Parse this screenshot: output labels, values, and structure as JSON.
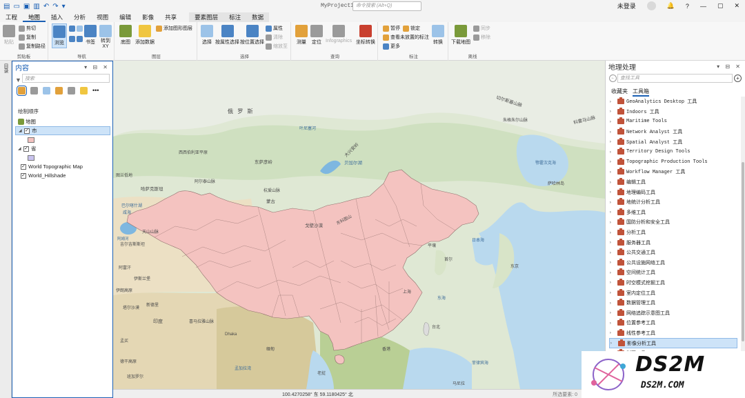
{
  "titlebar": {
    "project": "MyProject10",
    "command_search_placeholder": "命令搜索 (Alt+Q)",
    "signin": "未登录",
    "help": "?",
    "minimize": "—",
    "maximize": "▢",
    "close": "✕",
    "notify": "🔔"
  },
  "tabs": [
    "工程",
    "地图",
    "插入",
    "分析",
    "视图",
    "编辑",
    "影像",
    "共享",
    "要素图层",
    "标注",
    "数据"
  ],
  "ribbon": {
    "clipboard": {
      "label": "剪贴板",
      "paste": "粘贴",
      "cut": "剪切",
      "copy": "复制",
      "copy_path": "复制路径"
    },
    "navigate": {
      "label": "导航",
      "explore": "浏览",
      "bookmarks": "书签",
      "go_to": "转到 XY"
    },
    "layer": {
      "label": "图层",
      "basemap": "底图",
      "add_data": "添加数据",
      "add_graphics": "添加图形图层"
    },
    "selection": {
      "label": "选择",
      "select": "选择",
      "by_attr": "按属性选择",
      "by_loc": "按位置选择",
      "attributes": "属性",
      "clear": "清除",
      "zoom_to": "缩放至"
    },
    "inquiry": {
      "label": "查询",
      "measure": "测量",
      "locate": "定位",
      "infographics": "Infographics",
      "coord": "坐标转换"
    },
    "labeling": {
      "label": "标注",
      "pause": "暂停",
      "lock": "锁定",
      "view_unplaced": "查看未放置的标注",
      "more": "更多",
      "convert": "转换"
    },
    "offline": {
      "label": "离线",
      "download": "下载地图",
      "sync": "同步",
      "remove": "移除"
    }
  },
  "left_strip_label": "目录",
  "contents": {
    "title": "内容",
    "search_placeholder": "搜索",
    "drawing_order": "绘制顺序",
    "tree": [
      {
        "label": "地图",
        "level": 0
      },
      {
        "label": "市",
        "level": 1,
        "checked": true,
        "selected": true,
        "swatch": "#f4c3c0"
      },
      {
        "label": "省",
        "level": 1,
        "checked": true,
        "selected": false,
        "swatch": "#c9c3ee"
      },
      {
        "label": "World Topographic Map",
        "level": 1,
        "checked": true
      },
      {
        "label": "World_Hillshade",
        "level": 1,
        "checked": true
      }
    ]
  },
  "map_labels": [
    {
      "t": "俄 罗 斯",
      "id": "russia"
    },
    {
      "t": "贝加尔湖",
      "id": "baikal"
    },
    {
      "t": "东萨彦岭",
      "id": "esayan"
    },
    {
      "t": "叶尼塞河",
      "id": "yenisei"
    },
    {
      "t": "西西伯利亚平原",
      "id": "wsib"
    },
    {
      "t": "阿尔泰山脉",
      "id": "altai"
    },
    {
      "t": "哈萨克斯坦",
      "id": "kaz"
    },
    {
      "t": "咸海",
      "id": "aral"
    },
    {
      "t": "阿姆河",
      "id": "amu"
    },
    {
      "t": "巴尔喀什湖",
      "id": "balkhash"
    },
    {
      "t": "图兰低地",
      "id": "turan"
    },
    {
      "t": "吉尔吉斯斯坦",
      "id": "kyr"
    },
    {
      "t": "杭爱山脉",
      "id": "khangai"
    },
    {
      "t": "蒙古",
      "id": "mongolia"
    },
    {
      "t": "大兴安岭",
      "id": "dxa"
    },
    {
      "t": "切尔斯基山脉",
      "id": "chersky"
    },
    {
      "t": "朱格朱尔山脉",
      "id": "dzhug"
    },
    {
      "t": "鄂霍次克海",
      "id": "okhotsk"
    },
    {
      "t": "科雷马山脉",
      "id": "kolyma"
    },
    {
      "t": "萨哈林岛",
      "id": "sakhalin"
    },
    {
      "t": "阿拉伯海",
      "id": "arabian"
    },
    {
      "t": "平壤",
      "id": "pyongyang"
    },
    {
      "t": "日本海",
      "id": "japansea"
    },
    {
      "t": "首尔",
      "id": "seoul"
    },
    {
      "t": "东京",
      "id": "tokyo"
    },
    {
      "t": "天山山脉",
      "id": "tianshan"
    },
    {
      "t": "戈壁沙漠",
      "id": "gobi"
    },
    {
      "t": "阿富汗",
      "id": "afg"
    },
    {
      "t": "伊斯兰堡",
      "id": "isl"
    },
    {
      "t": "伊朗高原",
      "id": "iran"
    },
    {
      "t": "塔尔沙漠",
      "id": "thar"
    },
    {
      "t": "印度",
      "id": "india"
    },
    {
      "t": "新德里",
      "id": "delhi"
    },
    {
      "t": "喜马拉雅山脉",
      "id": "hima"
    },
    {
      "t": "上海",
      "id": "shanghai"
    },
    {
      "t": "东海",
      "id": "ecs"
    },
    {
      "t": "台北",
      "id": "taipei"
    },
    {
      "t": "台湾",
      "id": "taiwan"
    },
    {
      "t": "香港",
      "id": "hk"
    },
    {
      "t": "Dhaka",
      "id": "dhaka"
    },
    {
      "t": "缅甸",
      "id": "myanmar"
    },
    {
      "t": "孟加拉湾",
      "id": "bengal"
    },
    {
      "t": "达卡",
      "id": "dhaka2"
    },
    {
      "t": "孟买",
      "id": "mumbai"
    },
    {
      "t": "德干高原",
      "id": "deccan"
    },
    {
      "t": "班加罗尔",
      "id": "bangalore"
    },
    {
      "t": "菲律宾海",
      "id": "philsea"
    },
    {
      "t": "南海",
      "id": "scs"
    },
    {
      "t": "老挝",
      "id": "laos"
    },
    {
      "t": "阿拉伯海",
      "id": "arab2"
    },
    {
      "t": "马尼拉",
      "id": "manila"
    },
    {
      "t": "东萨彦岭",
      "id": "esayan2"
    },
    {
      "t": "东科图山",
      "id": "tk"
    }
  ],
  "statusbar": {
    "coords": "100.4270258° 东  59.1180425° 北",
    "selected": "所选要素: 0"
  },
  "geoprocessing": {
    "title": "地理处理",
    "search_placeholder": "查找工具",
    "tab_favorites": "收藏夹",
    "tab_toolboxes": "工具箱",
    "toolboxes": [
      "GeoAnalytics Desktop 工具",
      "Indoors 工具",
      "Maritime Tools",
      "Network Analyst 工具",
      "Spatial Analyst 工具",
      "Territory Design Tools",
      "Topographic Production Tools",
      "Workflow Manager 工具",
      "编辑工具",
      "地理编码工具",
      "地统计分析工具",
      "多维工具",
      "国防分析和安全工具",
      "分析工具",
      "服务器工具",
      "公共交通工具",
      "公共设施网络工具",
      "空间统计工具",
      "时空模式挖掘工具",
      "室内定位工具",
      "数据管理工具",
      "网络追踪示意图工具",
      "位置参考工具",
      "线性参考工具",
      "影像分析工具",
      "制图工具"
    ],
    "selected_index": 24
  },
  "watermark": {
    "big": "DS2M",
    "small": "DS2M.COM"
  },
  "colors": {
    "accent": "#1a5fb4",
    "china_fill": "#f4c3c0",
    "ocean": "#b9d9ee"
  }
}
